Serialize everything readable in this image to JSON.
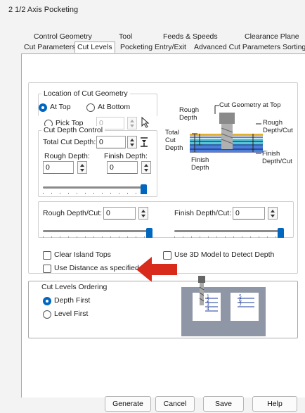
{
  "window": {
    "title": "2 1/2 Axis Pocketing"
  },
  "tabs_row1": [
    "Control Geometry",
    "Tool",
    "Feeds & Speeds",
    "Clearance Plane"
  ],
  "tabs_row2": [
    "Cut Parameters",
    "Cut Levels",
    "Pocketing Entry/Exit",
    "Advanced Cut Parameters",
    "Sorting"
  ],
  "active_tab": "Cut Levels",
  "location_group": {
    "label": "Location of Cut Geometry",
    "at_top": "At Top",
    "at_bottom": "At Bottom",
    "pick_top": "Pick Top",
    "pick_top_value": "0",
    "selected": "At Top"
  },
  "depth_group": {
    "label": "Cut Depth Control",
    "total_label": "Total Cut Depth:",
    "total_value": "0",
    "rough_label": "Rough Depth:",
    "rough_value": "0",
    "finish_label": "Finish Depth:",
    "finish_value": "0",
    "slider_value": 1.0
  },
  "diagram_top": {
    "rough_depth": "Rough\nDepth",
    "cut_geometry_at_top": "Cut Geometry at Top",
    "total_cut_depth": "Total\nCut\nDepth",
    "rough_depth_cut": "Rough\nDepth/Cut",
    "finish_depth": "Finish\nDepth",
    "finish_depth_cut": "Finish\nDepth/Cut"
  },
  "per_cut": {
    "rough_label": "Rough Depth/Cut:",
    "rough_value": "0",
    "finish_label": "Finish Depth/Cut:",
    "finish_value": "0",
    "rough_slider_value": 1.0,
    "finish_slider_value": 1.0
  },
  "options": {
    "clear_island_tops": "Clear Island Tops",
    "use_3d_model": "Use 3D Model to Detect Depth",
    "use_distance": "Use Distance as specified"
  },
  "ordering_group": {
    "label": "Cut Levels Ordering",
    "depth_first": "Depth First",
    "level_first": "Level First",
    "selected": "Depth First"
  },
  "diagram_bottom": {
    "labels": [
      "1",
      "2",
      "3",
      "4",
      "5",
      "6",
      "7"
    ]
  },
  "buttons": {
    "generate": "Generate",
    "cancel": "Cancel",
    "save": "Save",
    "help": "Help"
  },
  "colors": {
    "accent": "#0067c0",
    "annotation_arrow": "#d92b1c"
  }
}
